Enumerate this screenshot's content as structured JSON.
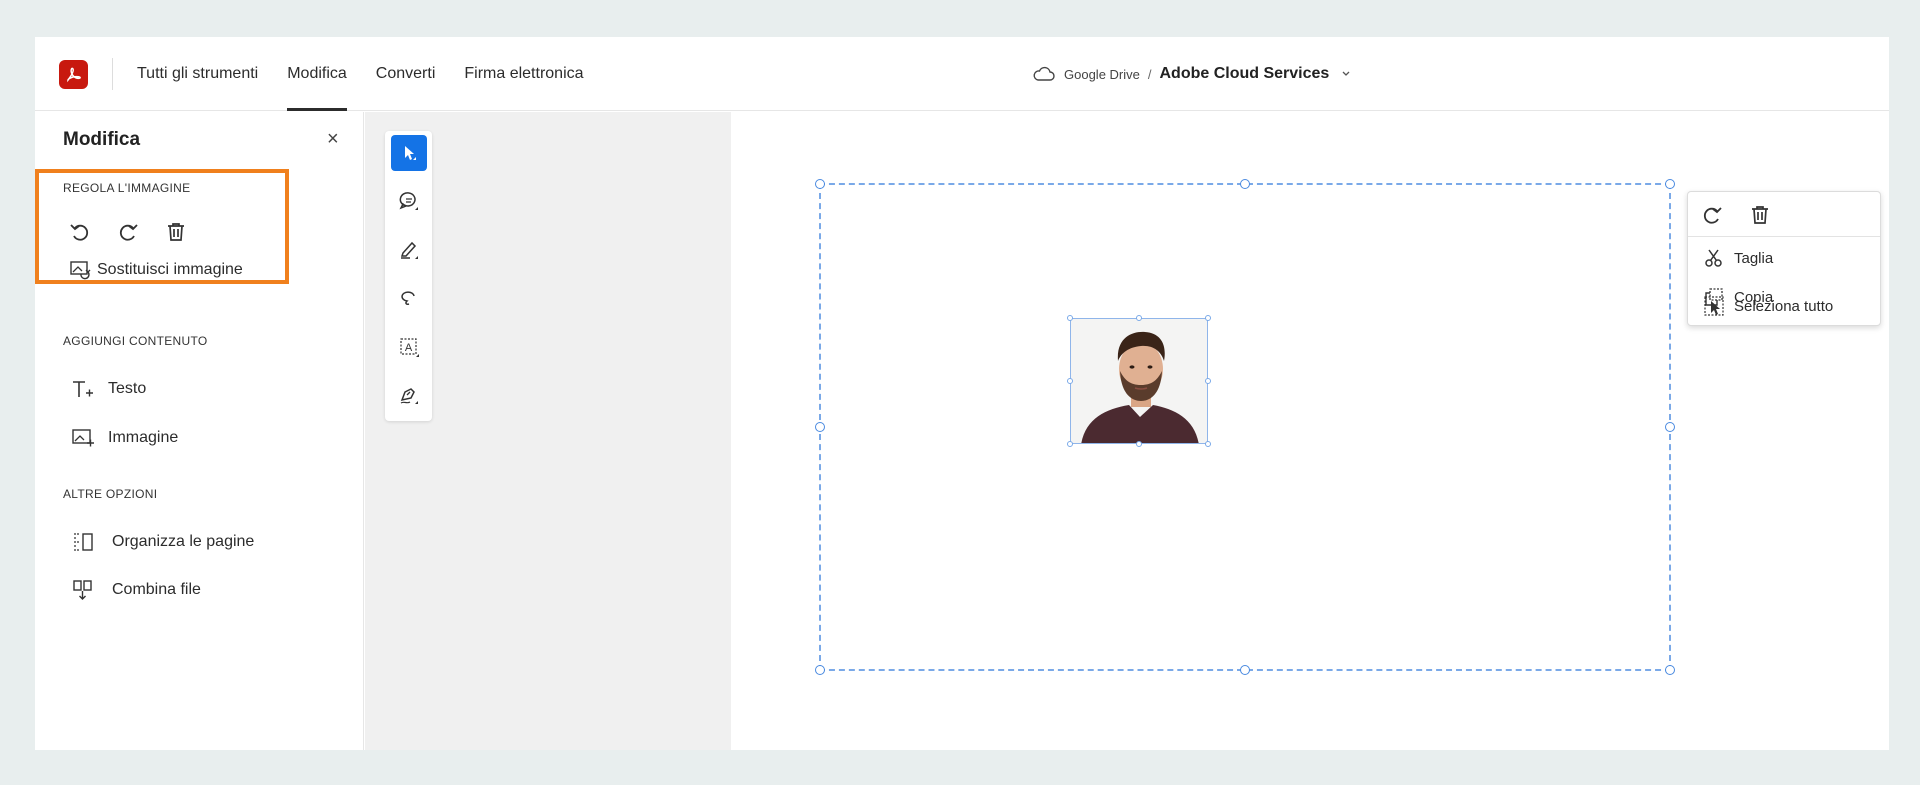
{
  "app": {
    "nav": [
      {
        "label": "Tutti gli strumenti",
        "active": false
      },
      {
        "label": "Modifica",
        "active": true
      },
      {
        "label": "Converti",
        "active": false
      },
      {
        "label": "Firma elettronica",
        "active": false
      }
    ],
    "breadcrumb": {
      "cloud_icon": "cloud-icon",
      "location": "Google Drive",
      "separator": "/",
      "title": "Adobe Cloud Services"
    }
  },
  "panel": {
    "title": "Modifica",
    "close_label": "×",
    "sections": {
      "adjust_label": "REGOLA L'IMMAGINE",
      "replace_label": "Sostituisci immagine",
      "add_label": "AGGIUNGI CONTENUTO",
      "add_items": [
        "Testo",
        "Immagine"
      ],
      "more_label": "ALTRE OPZIONI",
      "more_items": [
        "Organizza le pagine",
        "Combina file"
      ]
    },
    "highlight_color": "#f0801d"
  },
  "tools": [
    "select-tool",
    "comment-tool",
    "highlight-tool",
    "lasso-tool",
    "text-box-tool",
    "sign-tool"
  ],
  "context_menu": {
    "items": [
      "Taglia",
      "Copia",
      "Seleziona tutto"
    ]
  },
  "colors": {
    "accent": "#1473e6",
    "selection": "#7aa9e8",
    "brand": "#c8190f"
  }
}
